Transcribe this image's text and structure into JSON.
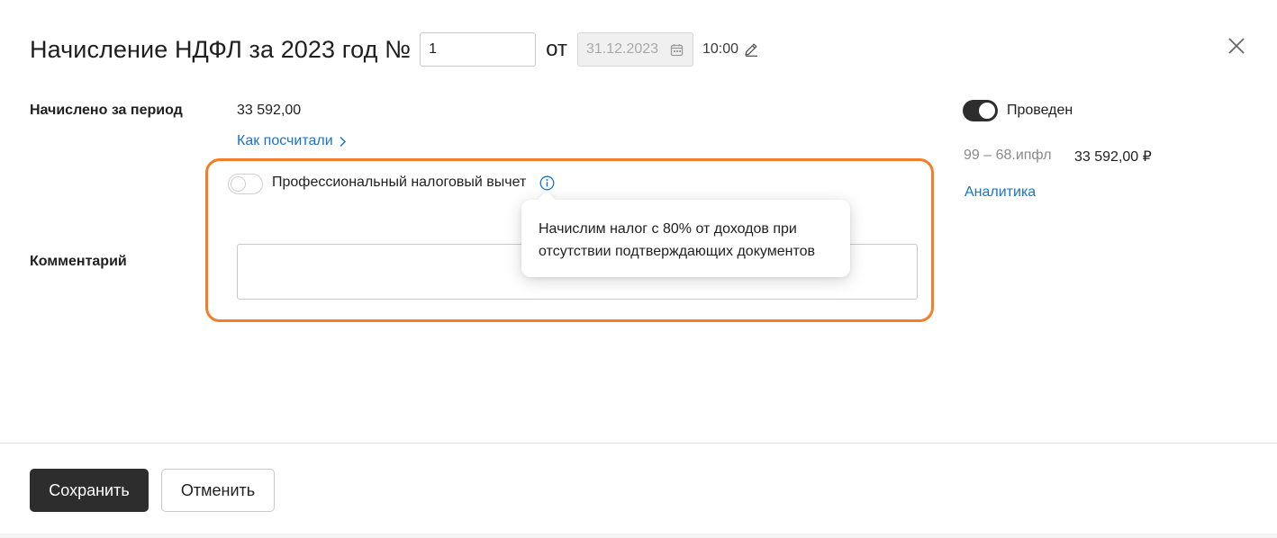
{
  "header": {
    "title": "Начисление НДФЛ за 2023 год №",
    "doc_number": "1",
    "date_prefix": "от",
    "date": "31.12.2023",
    "time": "10:00"
  },
  "icons": {
    "close": "close-icon",
    "calendar": "calendar-icon",
    "edit": "pencil-icon",
    "info": "info-icon",
    "chevron": "chevron-right-icon"
  },
  "form": {
    "accrued_label": "Начислено за период",
    "accrued_value": "33 592,00",
    "how_calculated_link": "Как посчитали",
    "prof_deduction_label": "Профессиональный налоговый вычет",
    "prof_deduction_enabled": false,
    "comment_label": "Комментарий",
    "comment_value": ""
  },
  "tooltip": {
    "text": "Начислим налог с 80% от доходов при отсутствии подтверждающих документов"
  },
  "side": {
    "posted_label": "Проведен",
    "posted_enabled": true,
    "account": "99 – 68.ипфл",
    "amount": "33 592,00 ₽",
    "analytics_link": "Аналитика"
  },
  "footer": {
    "save_label": "Сохранить",
    "cancel_label": "Отменить"
  },
  "colors": {
    "accent_link": "#1a73c8",
    "highlight_border": "#f47d29",
    "primary_button": "#2d2d2d"
  }
}
